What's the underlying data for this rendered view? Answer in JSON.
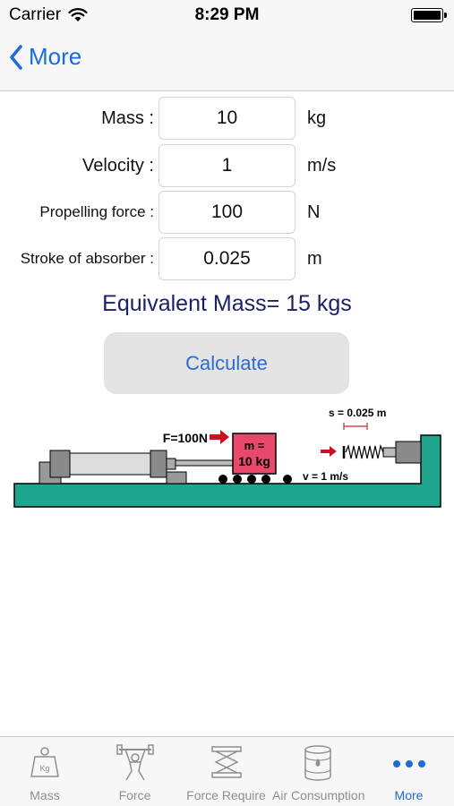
{
  "status_bar": {
    "carrier": "Carrier",
    "time": "8:29 PM"
  },
  "nav": {
    "back_label": "More"
  },
  "form": {
    "rows": [
      {
        "label": "Mass :",
        "value": "10",
        "unit": "kg"
      },
      {
        "label": "Velocity :",
        "value": "1",
        "unit": "m/s"
      },
      {
        "label": "Propelling force :",
        "value": "100",
        "unit": "N"
      },
      {
        "label": "Stroke of absorber :",
        "value": "0.025",
        "unit": "m"
      }
    ]
  },
  "result": "Equivalent Mass= 15 kgs",
  "calculate_label": "Calculate",
  "diagram": {
    "force_label": "F=100N",
    "mass_line1": "m =",
    "mass_line2": "10 kg",
    "velocity_label": "v = 1 m/s",
    "stroke_label": "s = 0.025 m"
  },
  "tabs": [
    {
      "label": "Mass",
      "icon": "kg-weight-icon",
      "active": false
    },
    {
      "label": "Force",
      "icon": "weightlifter-icon",
      "active": false
    },
    {
      "label": "Force Require",
      "icon": "scissor-lift-icon",
      "active": false
    },
    {
      "label": "Air Consumption",
      "icon": "oil-barrel-icon",
      "active": false
    },
    {
      "label": "More",
      "icon": "more-dots-icon",
      "active": true
    }
  ],
  "colors": {
    "accent": "#1a6cd8",
    "result_text": "#1b2166",
    "base": "#1fa58e",
    "mass_block": "#e8486b",
    "arrow": "#cc1122"
  }
}
